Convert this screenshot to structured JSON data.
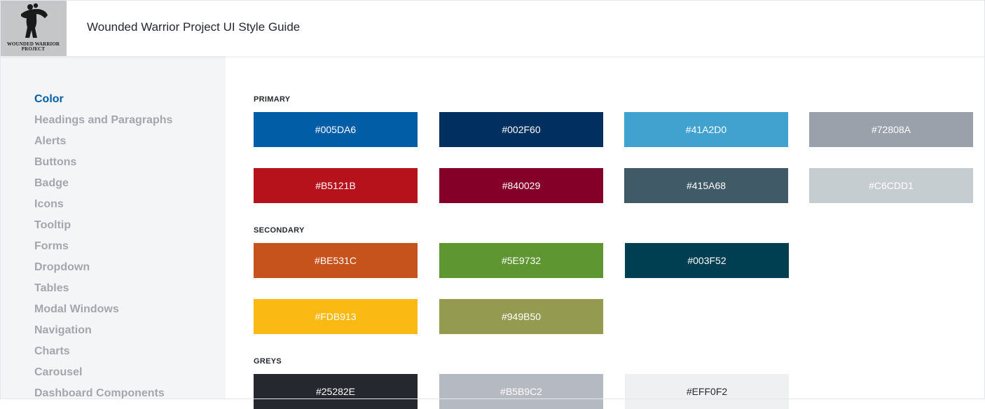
{
  "header": {
    "title": "Wounded Warrior Project UI Style Guide",
    "logo": {
      "line1": "WOUNDED WARRIOR",
      "line2": "PROJECT"
    }
  },
  "sidebar": {
    "items": [
      {
        "label": "Color",
        "active": true
      },
      {
        "label": "Headings and Paragraphs"
      },
      {
        "label": "Alerts"
      },
      {
        "label": "Buttons"
      },
      {
        "label": "Badge"
      },
      {
        "label": "Icons"
      },
      {
        "label": "Tooltip"
      },
      {
        "label": "Forms"
      },
      {
        "label": "Dropdown"
      },
      {
        "label": "Tables"
      },
      {
        "label": "Modal Windows"
      },
      {
        "label": "Navigation"
      },
      {
        "label": "Charts"
      },
      {
        "label": "Carousel"
      },
      {
        "label": "Dashboard Components"
      }
    ]
  },
  "sections": {
    "primary": {
      "label": "PRIMARY",
      "swatches": [
        {
          "hex": "#005DA6",
          "color": "#005da6"
        },
        {
          "hex": "#002F60",
          "color": "#002f60"
        },
        {
          "hex": "#41A2D0",
          "color": "#41a2d0"
        },
        {
          "hex": "#72808A",
          "color": "#9aa1aa"
        },
        {
          "hex": "#B5121B",
          "color": "#b5121b"
        },
        {
          "hex": "#840029",
          "color": "#840029"
        },
        {
          "hex": "#415A68",
          "color": "#415a68"
        },
        {
          "hex": "#C6CDD1",
          "color": "#c6cdd1"
        }
      ]
    },
    "secondary": {
      "label": "SECONDARY",
      "swatches": [
        {
          "hex": "#BE531C",
          "color": "#c6531c"
        },
        {
          "hex": "#5E9732",
          "color": "#5e9732"
        },
        {
          "hex": "#003F52",
          "color": "#003f52"
        },
        {
          "hex": "#FDB913",
          "color": "#fbb913"
        },
        {
          "hex": "#949B50",
          "color": "#949b50"
        }
      ]
    },
    "greys": {
      "label": "GREYS",
      "swatches": [
        {
          "hex": "#25282E",
          "color": "#25282e"
        },
        {
          "hex": "#B5B9C2",
          "color": "#b5b9c2"
        },
        {
          "hex": "#EFF0F2",
          "color": "#eff0f2"
        }
      ]
    }
  }
}
